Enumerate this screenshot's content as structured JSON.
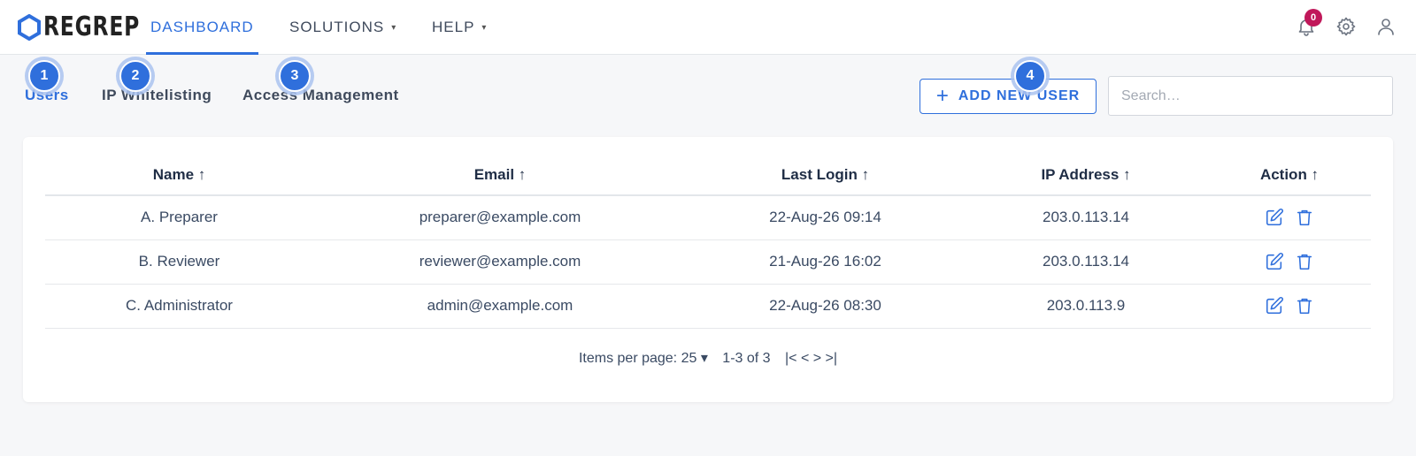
{
  "brand": {
    "logo_text": "REGREP"
  },
  "nav": {
    "items": [
      {
        "label": "DASHBOARD",
        "active": true
      },
      {
        "label": "SOLUTIONS",
        "caret": "▾"
      },
      {
        "label": "HELP",
        "caret": "▾"
      }
    ],
    "notification_count": "0",
    "icons": [
      "bell-icon",
      "gear-icon",
      "user-icon"
    ]
  },
  "subtabs": [
    {
      "label": "Users",
      "active": true,
      "marker": "1"
    },
    {
      "label": "IP Whitelisting",
      "marker": "2"
    },
    {
      "label": "Access Management",
      "marker": "3"
    }
  ],
  "toolbar": {
    "add_label": "ADD NEW USER",
    "add_marker": "4",
    "search_placeholder": "Search…"
  },
  "table": {
    "columns": [
      "Name ↑",
      "Email ↑",
      "Last Login ↑",
      "IP Address ↑",
      "Action ↑"
    ],
    "rows": [
      {
        "name": "A. Preparer",
        "email": "preparer@example.com",
        "last_login": "22-Aug-26 09:14",
        "ip": "203.0.113.14"
      },
      {
        "name": "B. Reviewer",
        "email": "reviewer@example.com",
        "last_login": "21-Aug-26 16:02",
        "ip": "203.0.113.14"
      },
      {
        "name": "C. Administrator",
        "email": "admin@example.com",
        "last_login": "22-Aug-26 08:30",
        "ip": "203.0.113.9"
      }
    ]
  },
  "pagination": {
    "items_per_page": "Items per page: 25 ▾",
    "range": "1-3 of 3",
    "controls": "|< < > >|"
  },
  "colors": {
    "accent": "#2f6fdc",
    "badge": "#c0185a"
  }
}
